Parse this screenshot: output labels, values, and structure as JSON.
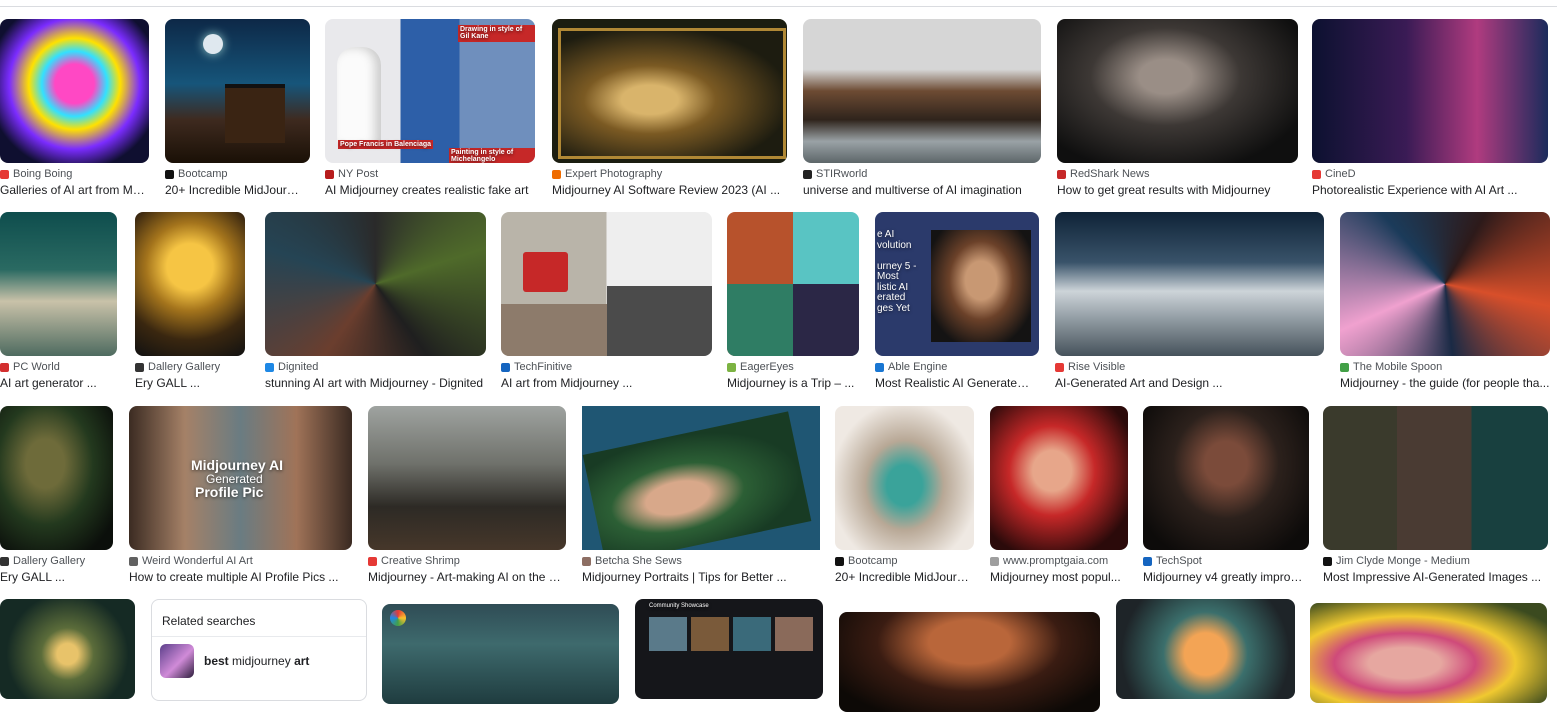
{
  "colors": {
    "title": "#202124",
    "source": "#4d5156",
    "border": "#dadce0"
  },
  "results": [
    {
      "source": "Boing Boing",
      "title": "Galleries of AI art from Mi...",
      "fav": "#e53935"
    },
    {
      "source": "Bootcamp",
      "title": "20+ Incredible MidJourn...",
      "fav": "#111111"
    },
    {
      "source": "NY Post",
      "title": "AI Midjourney creates realistic fake art",
      "fav": "#b71c1c"
    },
    {
      "source": "Expert Photography",
      "title": "Midjourney AI Software Review 2023 (AI ...",
      "fav": "#ef6c00"
    },
    {
      "source": "STIRworld",
      "title": "universe and multiverse of AI imagination",
      "fav": "#222222"
    },
    {
      "source": "RedShark News",
      "title": "How to get great results with Midjourney",
      "fav": "#c62828"
    },
    {
      "source": "CineD",
      "title": "Photorealistic Experience with AI Art ...",
      "fav": "#e53935"
    },
    {
      "source": "PC World",
      "title": "AI art generator ...",
      "fav": "#d32f2f"
    },
    {
      "source": "Dallery Gallery",
      "title": "Ery GALL ...",
      "fav": "#333333"
    },
    {
      "source": "Dignited",
      "title": "stunning AI art with Midjourney - Dignited",
      "fav": "#1e88e5"
    },
    {
      "source": "TechFinitive",
      "title": "AI art from Midjourney ...",
      "fav": "#1565c0"
    },
    {
      "source": "EagerEyes",
      "title": "Midjourney is a Trip – ...",
      "fav": "#7cb342"
    },
    {
      "source": "Able Engine",
      "title": "Most Realistic AI Generated I...",
      "fav": "#1976d2"
    },
    {
      "source": "Rise Visible",
      "title": "AI-Generated Art and Design ...",
      "fav": "#e53935"
    },
    {
      "source": "The Mobile Spoon",
      "title": "Midjourney - the guide (for people tha...",
      "fav": "#43a047"
    },
    {
      "source": "Dallery Gallery",
      "title": "Ery GALL ...",
      "fav": "#333333"
    },
    {
      "source": "Weird Wonderful AI Art",
      "title": "How to create multiple AI Profile Pics ...",
      "fav": "#616161"
    },
    {
      "source": "Creative Shrimp",
      "title": "Midjourney - Art-making AI on the R...",
      "fav": "#e53935"
    },
    {
      "source": "Betcha She Sews",
      "title": "Midjourney Portraits | Tips for Better ...",
      "fav": "#8d6e63"
    },
    {
      "source": "Bootcamp",
      "title": "20+ Incredible MidJourn...",
      "fav": "#111111"
    },
    {
      "source": "www.promptgaia.com",
      "title": "Midjourney most popul...",
      "fav": "#9e9e9e"
    },
    {
      "source": "TechSpot",
      "title": "Midjourney v4 greatly improv...",
      "fav": "#1565c0"
    },
    {
      "source": "Jim Clyde Monge - Medium",
      "title": "Most Impressive AI-Generated Images ...",
      "fav": "#111111"
    }
  ],
  "overlays": {
    "nypost_top": "Drawing in style of Gil Kane",
    "nypost_left": "Pope Francis in Balenciaga",
    "nypost_right": "Painting in style of Michelangelo",
    "able_text": "e AI\nvolution\n\nurney 5 -\nMost\nlistic AI\nerated\nges Yet",
    "profile_title": "Midjourney AI",
    "profile_sub": "Generated",
    "profile_sub2": "Profile Pic",
    "community": "Community Showcase"
  },
  "related": {
    "title": "Related searches",
    "item_bold1": "best",
    "item_normal": " midjourney ",
    "item_bold2": "art"
  }
}
